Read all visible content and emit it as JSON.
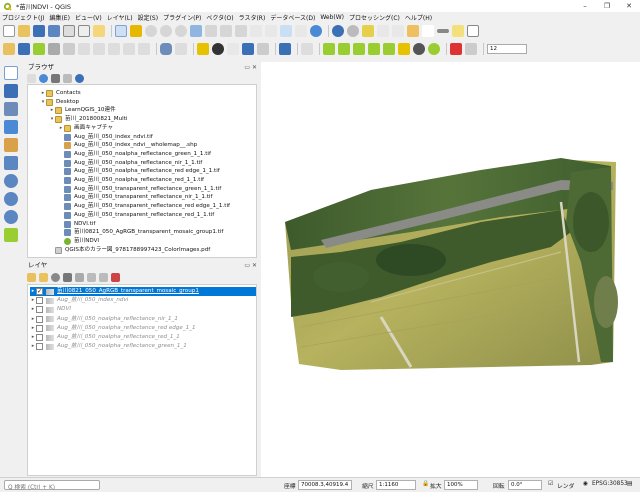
{
  "window": {
    "title": "*苗川NDVI - QGIS",
    "controls": [
      "–",
      "❐",
      "✕"
    ]
  },
  "menu": [
    "プロジェクト(J)",
    "編集(E)",
    "ビュー(V)",
    "レイヤ(L)",
    "設定(S)",
    "プラグイン(P)",
    "ベクタ(O)",
    "ラスタ(R)",
    "データベース(D)",
    "Web(W)",
    "プロセッシング(C)",
    "ヘルプ(H)"
  ],
  "toolbar2": {
    "scale_value": "12"
  },
  "browser": {
    "title": "ブラウザ",
    "items": [
      {
        "label": "Contacts",
        "type": "folder",
        "indent": 2,
        "arrow": "▸"
      },
      {
        "label": "Desktop",
        "type": "folder",
        "indent": 2,
        "arrow": "▾"
      },
      {
        "label": "LearnQGIS_10連件",
        "type": "folder",
        "indent": 3,
        "arrow": "▸"
      },
      {
        "label": "苗川_201800821_Multi",
        "type": "folder",
        "indent": 3,
        "arrow": "▾"
      },
      {
        "label": "画面キャプチャ",
        "type": "folder",
        "indent": 4,
        "arrow": "▸"
      },
      {
        "label": "Aug_苗川_050_index_ndvi.tif",
        "type": "tif",
        "indent": 4,
        "arrow": ""
      },
      {
        "label": "Aug_苗川_050_index_ndvi__wholemap__.shp",
        "type": "shp",
        "indent": 4,
        "arrow": ""
      },
      {
        "label": "Aug_苗川_050_noalpha_reflectance_green_1_1.tif",
        "type": "tif",
        "indent": 4,
        "arrow": ""
      },
      {
        "label": "Aug_苗川_050_noalpha_reflectance_nir_1_1.tif",
        "type": "tif",
        "indent": 4,
        "arrow": ""
      },
      {
        "label": "Aug_苗川_050_noalpha_reflectance_red edge_1_1.tif",
        "type": "tif",
        "indent": 4,
        "arrow": ""
      },
      {
        "label": "Aug_苗川_050_noalpha_reflectance_red_1_1.tif",
        "type": "tif",
        "indent": 4,
        "arrow": ""
      },
      {
        "label": "Aug_苗川_050_transparent_reflectance_green_1_1.tif",
        "type": "tif",
        "indent": 4,
        "arrow": ""
      },
      {
        "label": "Aug_苗川_050_transparent_reflectance_nir_1_1.tif",
        "type": "tif",
        "indent": 4,
        "arrow": ""
      },
      {
        "label": "Aug_苗川_050_transparent_reflectance_red edge_1_1.tif",
        "type": "tif",
        "indent": 4,
        "arrow": ""
      },
      {
        "label": "Aug_苗川_050_transparent_reflectance_red_1_1.tif",
        "type": "tif",
        "indent": 4,
        "arrow": ""
      },
      {
        "label": "NDVI.tif",
        "type": "tif",
        "indent": 4,
        "arrow": ""
      },
      {
        "label": "苗川0821_050_AgRGB_transparent_mosaic_group1.tif",
        "type": "tif",
        "indent": 4,
        "arrow": ""
      },
      {
        "label": "苗川NDVI",
        "type": "qgs",
        "indent": 4,
        "arrow": ""
      },
      {
        "label": "QGIS本のカラー図_9781788997423_ColorImages.pdf",
        "type": "pdf",
        "indent": 3,
        "arrow": ""
      }
    ]
  },
  "layers": {
    "title": "レイヤ",
    "items": [
      {
        "label": "苗川0821_050_AgRGB_transparent_mosaic_group1",
        "checked": true,
        "selected": true,
        "active": true
      },
      {
        "label": "Aug_苗川_050_index_ndvi",
        "checked": false,
        "selected": false,
        "active": false
      },
      {
        "label": "NDVI",
        "checked": false,
        "selected": false,
        "active": false
      },
      {
        "label": "Aug_苗川_050_noalpha_reflectance_nir_1_1",
        "checked": false,
        "selected": false,
        "active": false
      },
      {
        "label": "Aug_苗川_050_noalpha_reflectance_red edge_1_1",
        "checked": false,
        "selected": false,
        "active": false
      },
      {
        "label": "Aug_苗川_050_noalpha_reflectance_red_1_1",
        "checked": false,
        "selected": false,
        "active": false
      },
      {
        "label": "Aug_苗川_050_noalpha_reflectance_green_1_1",
        "checked": false,
        "selected": false,
        "active": false
      }
    ]
  },
  "status": {
    "search_placeholder": "Q  検索 (Ctrl + K)",
    "coord_label": "座標",
    "coord_value": "70008.3,40919.4",
    "scale_label": "縮尺",
    "scale_value": "1:1160",
    "magnifier_label": "拡大",
    "magnifier_value": "100%",
    "rotation_label": "回転",
    "rotation_value": "0.0°",
    "render_label": "レンダ",
    "crs": "EPSG:30853"
  }
}
